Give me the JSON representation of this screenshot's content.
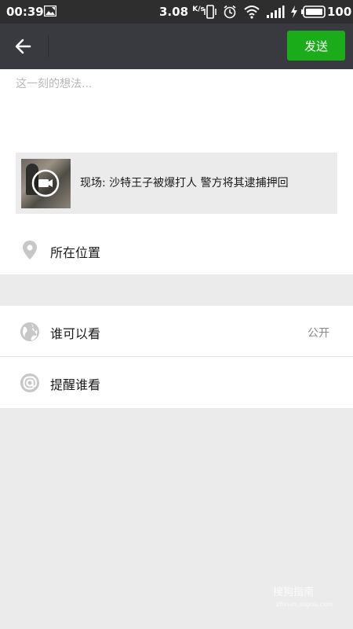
{
  "status_bar": {
    "time": "00:39",
    "speed_value": "3.08",
    "speed_unit": "K/s",
    "battery": "100"
  },
  "header": {
    "send_label": "发送"
  },
  "compose": {
    "placeholder": "这一刻的想法...",
    "shared_title": "现场: 沙特王子被爆打人 警方将其逮捕押回"
  },
  "location": {
    "label": "所在位置"
  },
  "settings": {
    "visibility_label": "谁可以看",
    "visibility_value": "公开",
    "remind_label": "提醒谁看"
  },
  "watermark": {
    "text": "搜狗指南",
    "sub": "zhinan.sogou.com"
  },
  "icons": {
    "back": "arrow-left-icon",
    "location": "location-pin-icon",
    "visibility": "globe-icon",
    "remind": "at-sign-icon",
    "video": "video-camera-icon"
  },
  "colors": {
    "header_bg": "#393a3f",
    "status_bg": "#2e2e2e",
    "send_button": "#1aad19",
    "page_bg": "#ebebeb",
    "icon_gray": "#c7c7c7"
  }
}
